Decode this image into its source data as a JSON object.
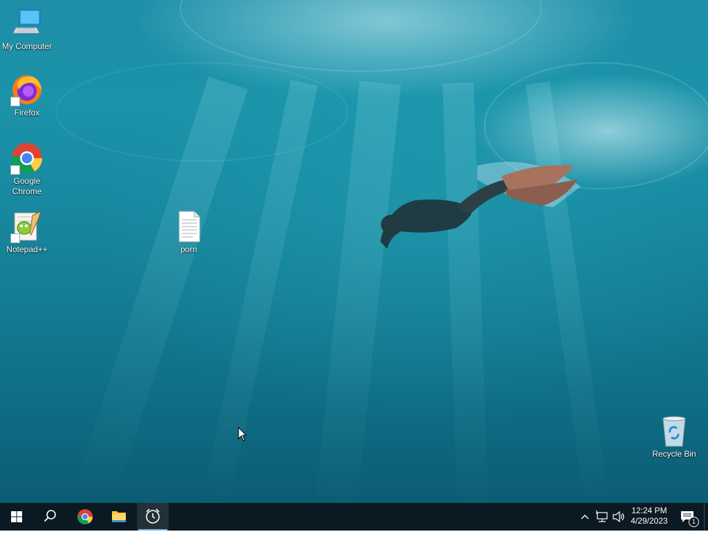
{
  "desktop": {
    "icons": [
      {
        "label": "My Computer",
        "icon": "my-computer-icon"
      },
      {
        "label": "Firefox",
        "icon": "firefox-icon"
      },
      {
        "label": "Google Chrome",
        "icon": "chrome-icon"
      },
      {
        "label": "Notepad++",
        "icon": "notepadpp-icon"
      },
      {
        "label": "porn",
        "icon": "text-file-icon"
      },
      {
        "label": "Recycle Bin",
        "icon": "recycle-bin-icon"
      }
    ]
  },
  "taskbar": {
    "buttons": [
      {
        "name": "start",
        "icon": "windows-logo-icon"
      },
      {
        "name": "search",
        "icon": "search-icon"
      },
      {
        "name": "chrome",
        "icon": "chrome-icon"
      },
      {
        "name": "file-explorer",
        "icon": "folder-icon"
      },
      {
        "name": "alarms-clock",
        "icon": "alarm-clock-icon",
        "active": true
      }
    ],
    "tray": {
      "time": "12:24 PM",
      "date": "4/29/2023",
      "notification_count": "1"
    }
  },
  "colors": {
    "taskbar_bg": "#0b1922",
    "accent": "#76b9ed",
    "water": "#1789a0"
  }
}
